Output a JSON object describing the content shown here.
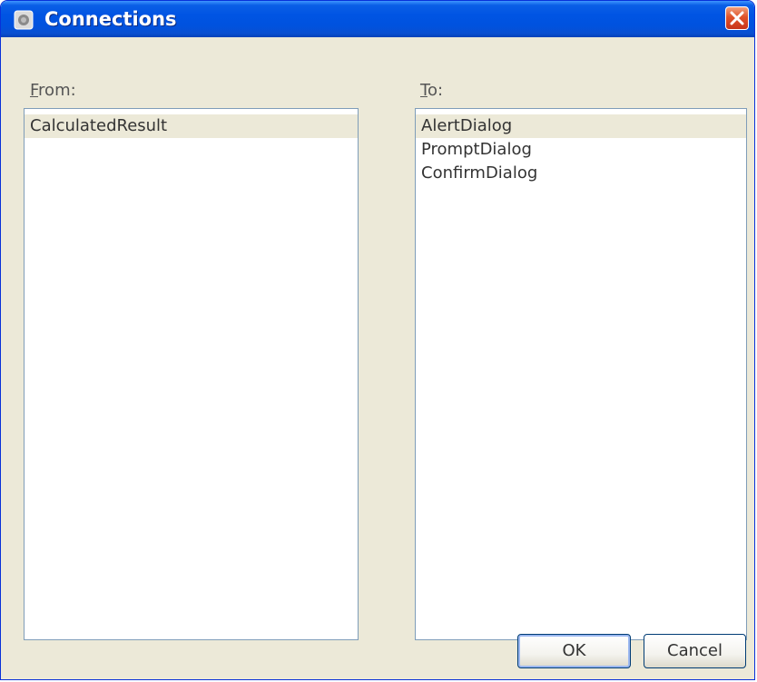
{
  "window": {
    "title": "Connections",
    "close_icon": "close-icon",
    "app_icon": "app-icon"
  },
  "from": {
    "label_mnemonic": "F",
    "label_rest": "rom:",
    "items": [
      {
        "label": "CalculatedResult",
        "selected": true
      }
    ]
  },
  "to": {
    "label_mnemonic": "T",
    "label_rest": "o:",
    "items": [
      {
        "label": "AlertDialog",
        "selected": true
      },
      {
        "label": "PromptDialog",
        "selected": false
      },
      {
        "label": "ConfirmDialog",
        "selected": false
      }
    ]
  },
  "buttons": {
    "ok_label": "OK",
    "cancel_label": "Cancel"
  },
  "colors": {
    "titlebar": "#0054e3",
    "window_bg": "#ece9d8",
    "selection_bg": "#ece9d8",
    "close_red": "#e0532a"
  }
}
